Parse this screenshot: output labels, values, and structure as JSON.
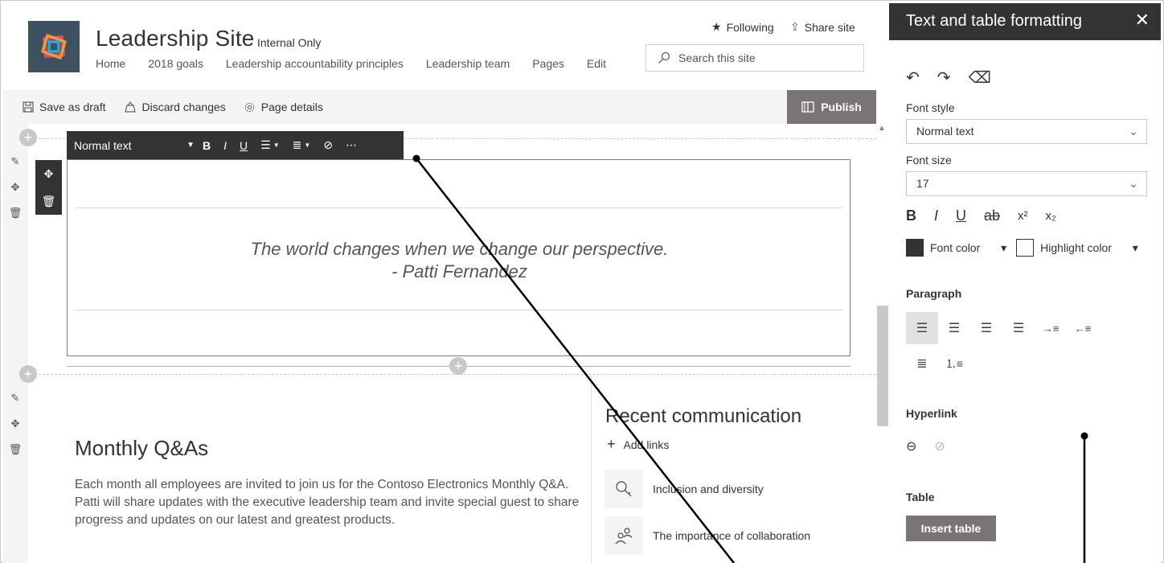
{
  "site": {
    "title": "Leadership Site",
    "badge": "Internal Only",
    "nav": [
      "Home",
      "2018 goals",
      "Leadership accountability principles",
      "Leadership team",
      "Pages",
      "Edit"
    ],
    "following": "Following",
    "share": "Share site",
    "search_placeholder": "Search this site"
  },
  "cmdbar": {
    "save": "Save as draft",
    "discard": "Discard changes",
    "details": "Page details",
    "publish": "Publish"
  },
  "text_toolbar": {
    "style": "Normal text",
    "bold": "B",
    "italic": "I",
    "underline": "U",
    "more": "⋯"
  },
  "quote": {
    "line1": "The world changes when we change our perspective.",
    "line2": "- Patti Fernandez"
  },
  "monthly": {
    "title": "Monthly Q&As",
    "body": "Each month all employees are invited to join us for the Contoso Electronics Monthly Q&A. Patti will share updates with the executive leadership team and invite special guest to share progress and updates on our latest and greatest products."
  },
  "recent": {
    "title": "Recent communication",
    "add": "Add links",
    "items": [
      "Inclusion and diversity",
      "The importance of collaboration"
    ]
  },
  "panel": {
    "title": "Text and table formatting",
    "font_style_label": "Font style",
    "font_style_value": "Normal text",
    "font_size_label": "Font size",
    "font_size_value": "17",
    "font_color": "Font color",
    "highlight_color": "Highlight color",
    "paragraph": "Paragraph",
    "hyperlink": "Hyperlink",
    "table": "Table",
    "insert_table": "Insert table"
  },
  "colors": {
    "dark": "#333333",
    "publish": "#7a7574",
    "gutter": "#f4f4f4"
  }
}
